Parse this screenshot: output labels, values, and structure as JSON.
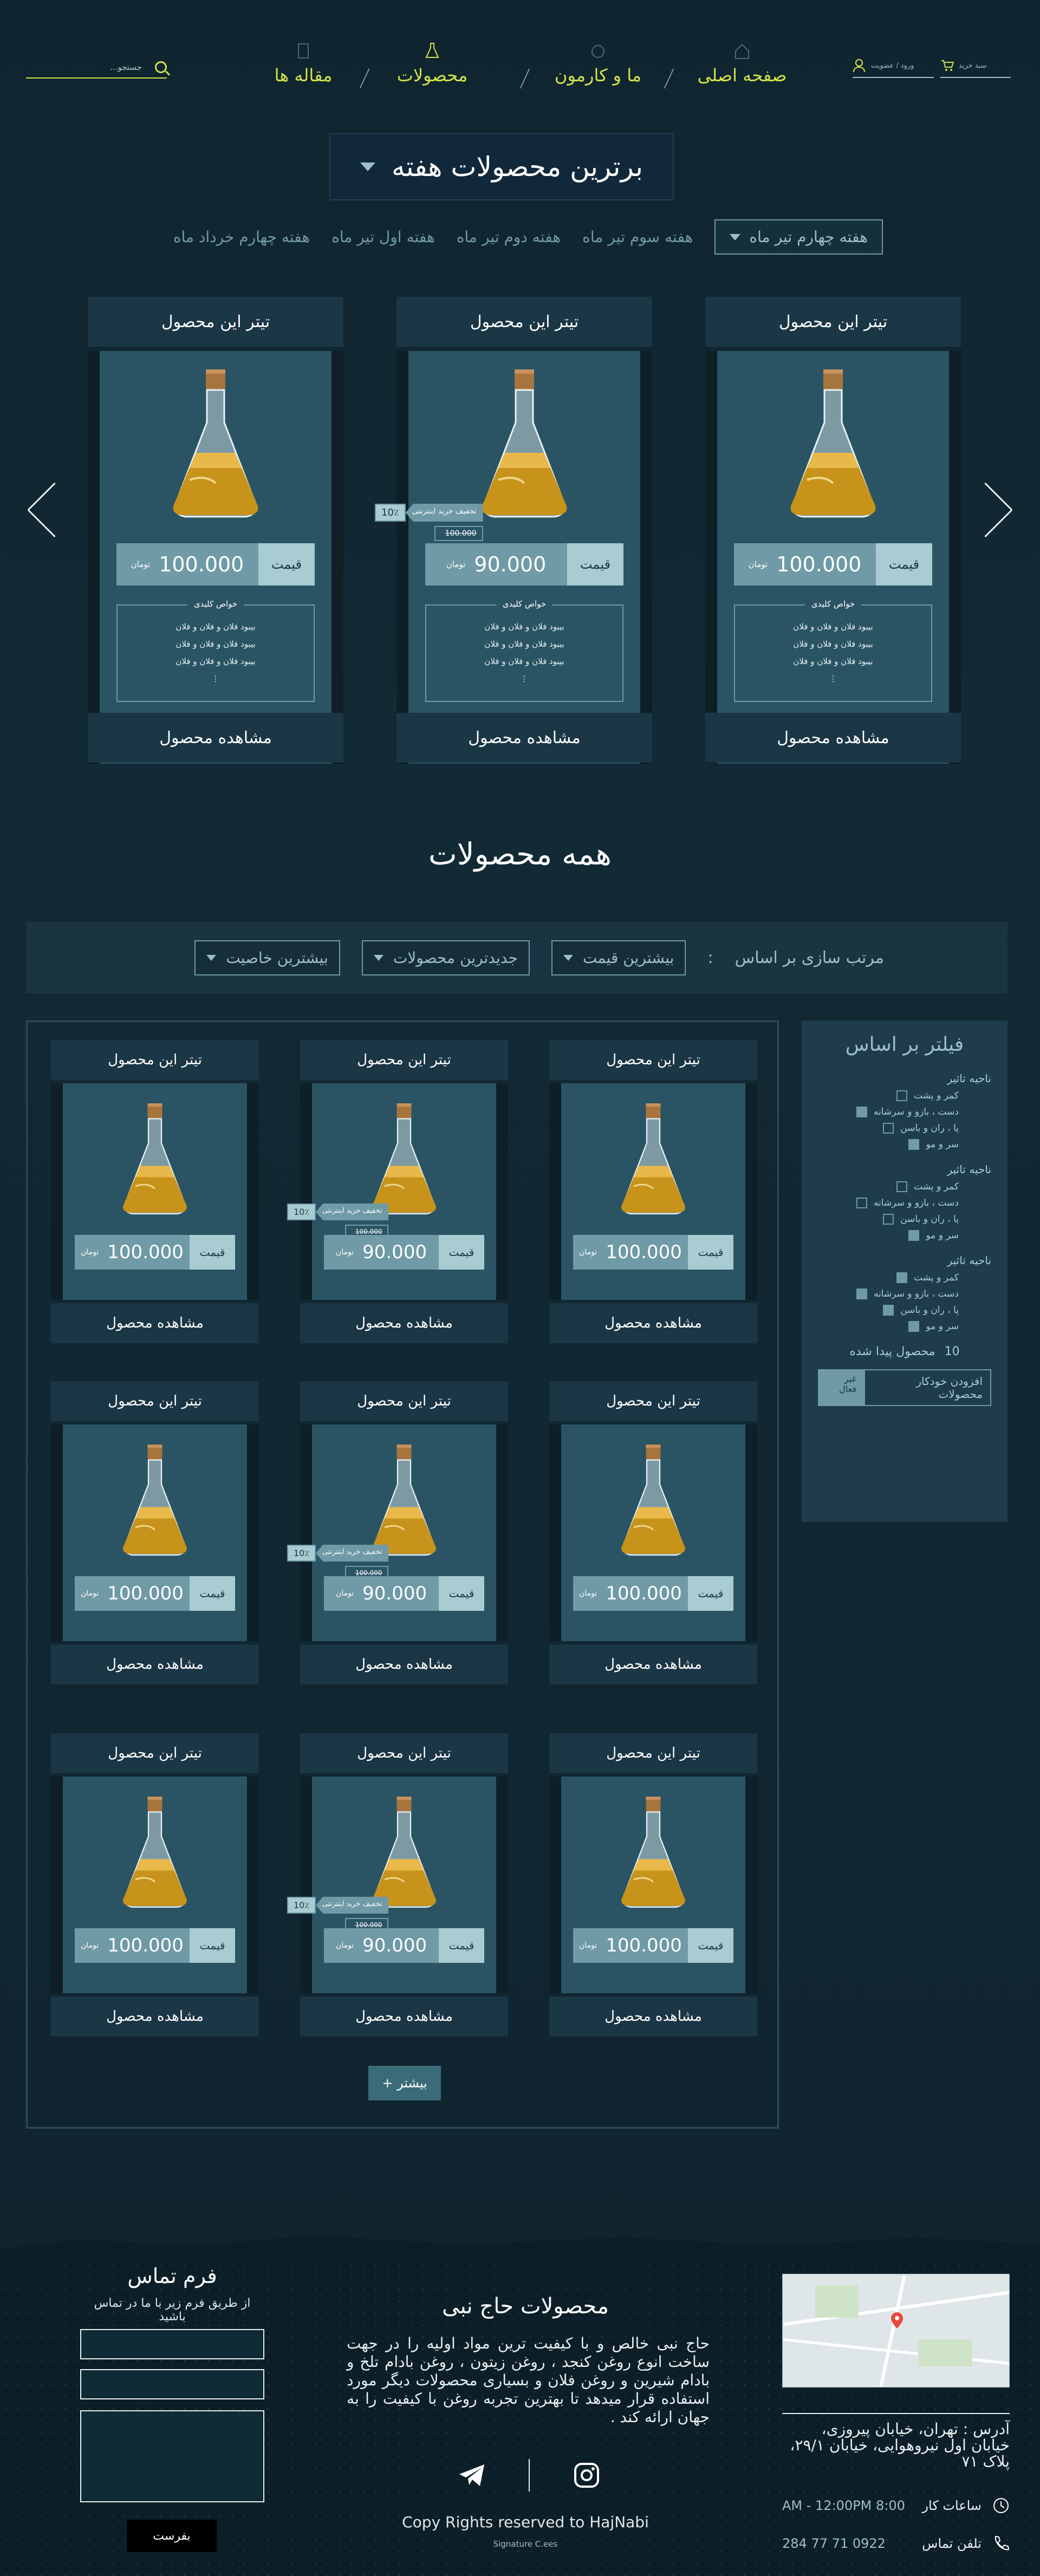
{
  "nav": {
    "cart_label": "سبد خرید",
    "login_label": "ورود / عضویت",
    "links": [
      "صفحه اصلی",
      "ما و کارمون",
      "محصولات",
      "مقاله ها"
    ],
    "search_placeholder": "جستجو..."
  },
  "weekly": {
    "title": "برترین محصولات هفته",
    "tabs": [
      "هفته چهارم تیر ماه",
      "هفته سوم تیر ماه",
      "هفته دوم تیر ماه",
      "هفته اول تیر ماه",
      "هفته چهارم خرداد ماه"
    ]
  },
  "product_common": {
    "title": "تیتر این محصول",
    "price_label": "قیمت",
    "currency": "تومان",
    "props_title": "خواص کلیدی",
    "props": [
      "بیبود فلان و فلان و فلان",
      "بیبود فلان و فلان و فلان",
      "بیبود فلان و فلان و فلان"
    ],
    "view_label": "مشاهده محصول",
    "discount_label": "تخفیف خرید اینترنتی",
    "discount_pct": "10٪"
  },
  "weekly_products": [
    {
      "price": "100.000",
      "discounted": false,
      "old_price": ""
    },
    {
      "price": "90.000",
      "discounted": true,
      "old_price": "100.000"
    },
    {
      "price": "100.000",
      "discounted": false,
      "old_price": ""
    }
  ],
  "all": {
    "title": "همه محصولات",
    "sort_label": "مرتب سازی بر اساس",
    "sort_colon": ":",
    "sort_options": [
      "بیشترین قیمت",
      "جدیدترین محصولات",
      "بیشترین خاصیت"
    ],
    "more_label": "بیشتر +"
  },
  "filter": {
    "title": "فیلتر بر اساس",
    "groups": [
      {
        "title": "ناحیه تاثیر",
        "items": [
          {
            "label": "کمر و پشت",
            "checked": false
          },
          {
            "label": "دست ، بازو و سرشانه",
            "checked": true
          },
          {
            "label": "پا ، ران و باسن",
            "checked": false
          },
          {
            "label": "سر و مو",
            "checked": true
          }
        ]
      },
      {
        "title": "ناحیه تاثیر",
        "items": [
          {
            "label": "کمر و پشت",
            "checked": false
          },
          {
            "label": "دست ، بازو و سرشانه",
            "checked": false
          },
          {
            "label": "پا ، ران و باسن",
            "checked": false
          },
          {
            "label": "سر و مو",
            "checked": true
          }
        ]
      },
      {
        "title": "ناحیه تاثیر",
        "items": [
          {
            "label": "کمر و پشت",
            "checked": true
          },
          {
            "label": "دست ، بازو و سرشانه",
            "checked": true
          },
          {
            "label": "پا ، ران و باسن",
            "checked": true
          },
          {
            "label": "سر و مو",
            "checked": true
          }
        ]
      }
    ],
    "found_count": "10",
    "found_label": "محصول پیدا شده",
    "auto_add_label": "افزودن خودکار محصولات",
    "auto_state": "غیر فعال"
  },
  "grid_products": [
    {
      "price": "100.000",
      "discounted": false,
      "old_price": ""
    },
    {
      "price": "90.000",
      "discounted": true,
      "old_price": "100.000"
    },
    {
      "price": "100.000",
      "discounted": false,
      "old_price": ""
    },
    {
      "price": "100.000",
      "discounted": false,
      "old_price": ""
    },
    {
      "price": "90.000",
      "discounted": true,
      "old_price": "100.000"
    },
    {
      "price": "100.000",
      "discounted": false,
      "old_price": ""
    },
    {
      "price": "100.000",
      "discounted": false,
      "old_price": ""
    },
    {
      "price": "90.000",
      "discounted": true,
      "old_price": "100.000"
    },
    {
      "price": "100.000",
      "discounted": false,
      "old_price": ""
    }
  ],
  "footer": {
    "contact_title": "فرم تماس",
    "contact_sub": "از طریق فرم زیر با ما در تماس باشید",
    "send_label": "بفرست",
    "about_title": "محصولات حاج نبی",
    "about_text": "حاج نبی خالص و با کیفیت ترین مواد اولیه را در جهت ساخت انوع روغن کنجد ، روغن زیتون ، روغن بادام تلخ و بادام شیرین و روغن فلان و بسیاری محصولات دیگر مورد استفاده قرار میدهد تا بهترین تجربه روغن با کیفیت را به جهان ارائه کند .",
    "copyright": "Copy Rights reserved to HajNabi",
    "signature": "Signature C.ees",
    "address": "آدرس : تهران، خیابان پیروزی، خیابان اول نیروهوایی، خیابان ۲۹/۱، پلاک ۷۱",
    "hours_label": "ساعات کار",
    "hours_value": "8:00 AM - 12:00PM",
    "phone_label": "تلفن تماس",
    "phone_value": "0922 71 77 284"
  },
  "colors": {
    "accent": "#d6e24a",
    "card": "#2a5464",
    "panel": "#1b3645",
    "price_label": "#a9ccd2",
    "price_value": "#6f9aa6"
  }
}
